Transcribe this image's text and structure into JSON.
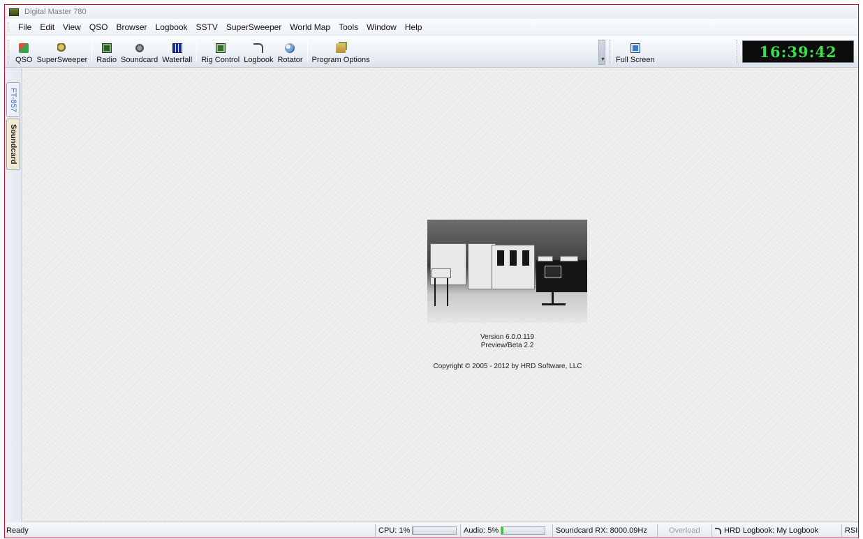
{
  "window": {
    "title": "Digital Master 780"
  },
  "menu": [
    "File",
    "Edit",
    "View",
    "QSO",
    "Browser",
    "Logbook",
    "SSTV",
    "SuperSweeper",
    "World Map",
    "Tools",
    "Window",
    "Help"
  ],
  "toolbar": {
    "qso": {
      "label": "QSO",
      "icon": "qso-icon"
    },
    "supersweeper": {
      "label": "SuperSweeper",
      "icon": "supersweeper-icon"
    },
    "radio": {
      "label": "Radio",
      "icon": "radio-icon"
    },
    "soundcard": {
      "label": "Soundcard",
      "icon": "soundcard-icon"
    },
    "waterfall": {
      "label": "Waterfall",
      "icon": "waterfall-icon"
    },
    "rig_control": {
      "label": "Rig Control",
      "icon": "rig-control-icon"
    },
    "logbook": {
      "label": "Logbook",
      "icon": "logbook-icon"
    },
    "rotator": {
      "label": "Rotator",
      "icon": "rotator-icon"
    },
    "program_options": {
      "label": "Program Options",
      "icon": "program-options-icon"
    },
    "full_screen": {
      "label": "Full Screen",
      "icon": "full-screen-icon"
    }
  },
  "clock": "16:39:42",
  "side_tabs": [
    "FT-857",
    "Soundcard"
  ],
  "splash": {
    "version": "Version 6.0.0.119",
    "build": "Preview/Beta 2.2",
    "copyright": "Copyright © 2005 - 2012 by HRD Software, LLC"
  },
  "status": {
    "ready": "Ready",
    "cpu_label": "CPU: 1%",
    "cpu_percent": 1,
    "audio_label": "Audio: 5%",
    "audio_percent": 5,
    "soundcard": "Soundcard RX: 8000.09Hz",
    "overload": "Overload",
    "logbook": "HRD Logbook: My Logbook",
    "rsid": "RSID"
  }
}
